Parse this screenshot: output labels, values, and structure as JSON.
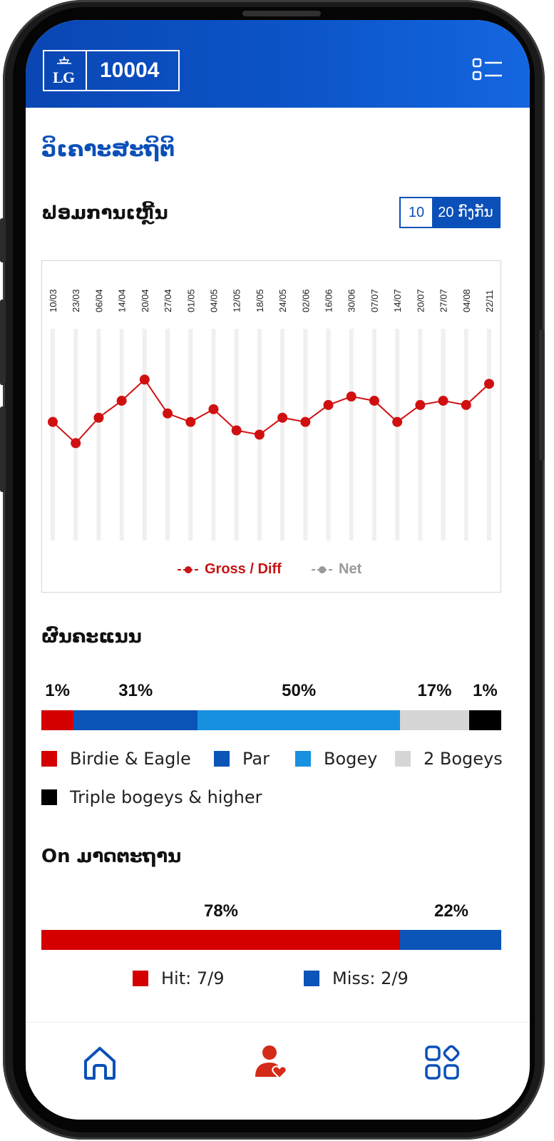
{
  "header": {
    "member_id": "10004",
    "logo_text": "LG"
  },
  "page": {
    "title": "ວິເຄາະສະຖິຕິ"
  },
  "form_section": {
    "title": "ຟອມການເຫຼີ້ນ",
    "toggle_a": "10",
    "toggle_b": "20 ກົງກັນ",
    "legend_gross": "Gross / Diff",
    "legend_net": "Net"
  },
  "chart_data": {
    "type": "line",
    "x": [
      "10/03",
      "23/03",
      "06/04",
      "14/04",
      "20/04",
      "27/04",
      "01/05",
      "04/05",
      "12/05",
      "18/05",
      "24/05",
      "02/06",
      "16/06",
      "30/06",
      "07/07",
      "14/07",
      "20/07",
      "27/07",
      "04/08",
      "22/11"
    ],
    "series": [
      {
        "name": "Gross / Diff",
        "color": "#d01010",
        "values": [
          88,
          83,
          89,
          93,
          98,
          90,
          88,
          91,
          86,
          85,
          89,
          88,
          92,
          94,
          93,
          88,
          92,
          93,
          92,
          97
        ]
      },
      {
        "name": "Net",
        "color": "#999999",
        "values": []
      }
    ],
    "ylim": [
      60,
      110
    ],
    "grid": true,
    "legend": "bottom"
  },
  "score_section": {
    "title": "ຜົນຄະແນນ",
    "segments": [
      {
        "label": "Birdie & Eagle",
        "pct": "1%",
        "value": 7,
        "color": "#d40000"
      },
      {
        "label": "Par",
        "pct": "31%",
        "value": 27,
        "color": "#0b54b8"
      },
      {
        "label": "Bogey",
        "pct": "50%",
        "value": 44,
        "color": "#1890e0"
      },
      {
        "label": "2 Bogeys",
        "pct": "17%",
        "value": 15,
        "color": "#d6d6d6"
      },
      {
        "label": "Triple bogeys & higher",
        "pct": "1%",
        "value": 7,
        "color": "#000000"
      }
    ]
  },
  "on_section": {
    "title": "On ມາດຕະຖານ",
    "hit_pct": "78%",
    "miss_pct": "22%",
    "hit_label": "Hit: 7/9",
    "miss_label": "Miss: 2/9",
    "hit_value": 78,
    "miss_value": 22,
    "hit_color": "#d40000",
    "miss_color": "#0b54b8"
  },
  "nav": {
    "items": [
      "home-icon",
      "profile-heart-icon",
      "apps-icon"
    ]
  }
}
